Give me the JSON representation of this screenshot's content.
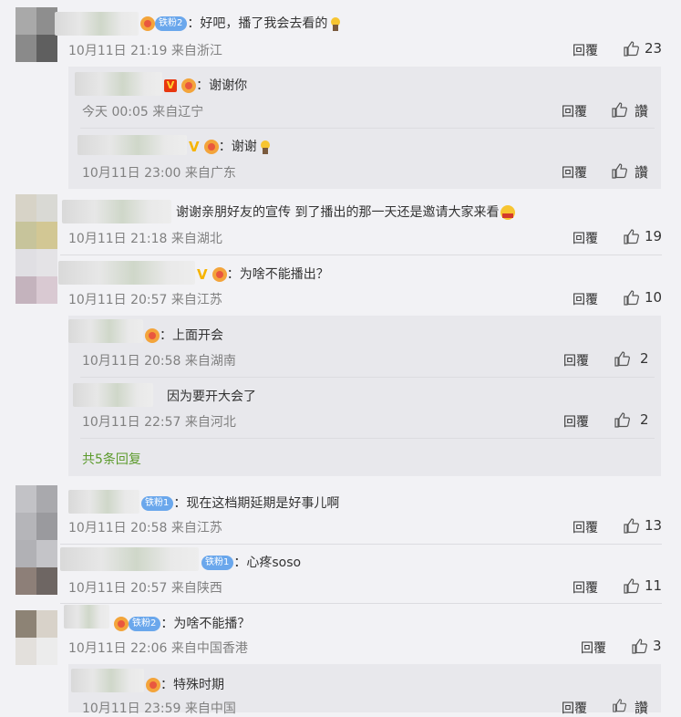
{
  "comments": [
    {
      "badge": "铁粉2",
      "text": "：好吧，播了我会去看的",
      "time": "10月11日 21:19 来自浙江",
      "reply": "回覆",
      "likes": "23",
      "replies": [
        {
          "text": "：谢谢你",
          "time": "今天 00:05 来自辽宁",
          "reply": "回覆",
          "likes": "讚"
        },
        {
          "text": "：谢谢",
          "time": "10月11日 23:00 来自广东",
          "reply": "回覆",
          "likes": "讚"
        }
      ]
    },
    {
      "text": "谢谢亲朋好友的宣传 到了播出的那一天还是邀请大家来看",
      "time": "10月11日 21:18 来自湖北",
      "reply": "回覆",
      "likes": "19"
    },
    {
      "text": "：为啥不能播出？",
      "time": "10月11日 20:57 来自江苏",
      "reply": "回覆",
      "likes": "10",
      "replies": [
        {
          "text": "：上面开会",
          "time": "10月11日 20:58 来自湖南",
          "reply": "回覆",
          "likes": "2"
        },
        {
          "text": "因为要开大会了",
          "time": "10月11日 22:57 来自河北",
          "reply": "回覆",
          "likes": "2"
        }
      ],
      "more": "共5条回复"
    },
    {
      "badge": "铁粉1",
      "text": "：现在这档期延期是好事儿啊",
      "time": "10月11日 20:58 来自江苏",
      "reply": "回覆",
      "likes": "13"
    },
    {
      "badge": "铁粉1",
      "text": "：心疼soso",
      "time": "10月11日 20:57 来自陕西",
      "reply": "回覆",
      "likes": "11"
    },
    {
      "badge": "铁粉2",
      "text": "：为啥不能播？",
      "time": "10月11日 22:06 来自中国香港",
      "reply": "回覆",
      "likes": "3",
      "replies": [
        {
          "text": "：特殊时期",
          "time": "10月11日 23:59 来自中国",
          "reply": "回覆",
          "likes": "讚"
        }
      ]
    }
  ]
}
